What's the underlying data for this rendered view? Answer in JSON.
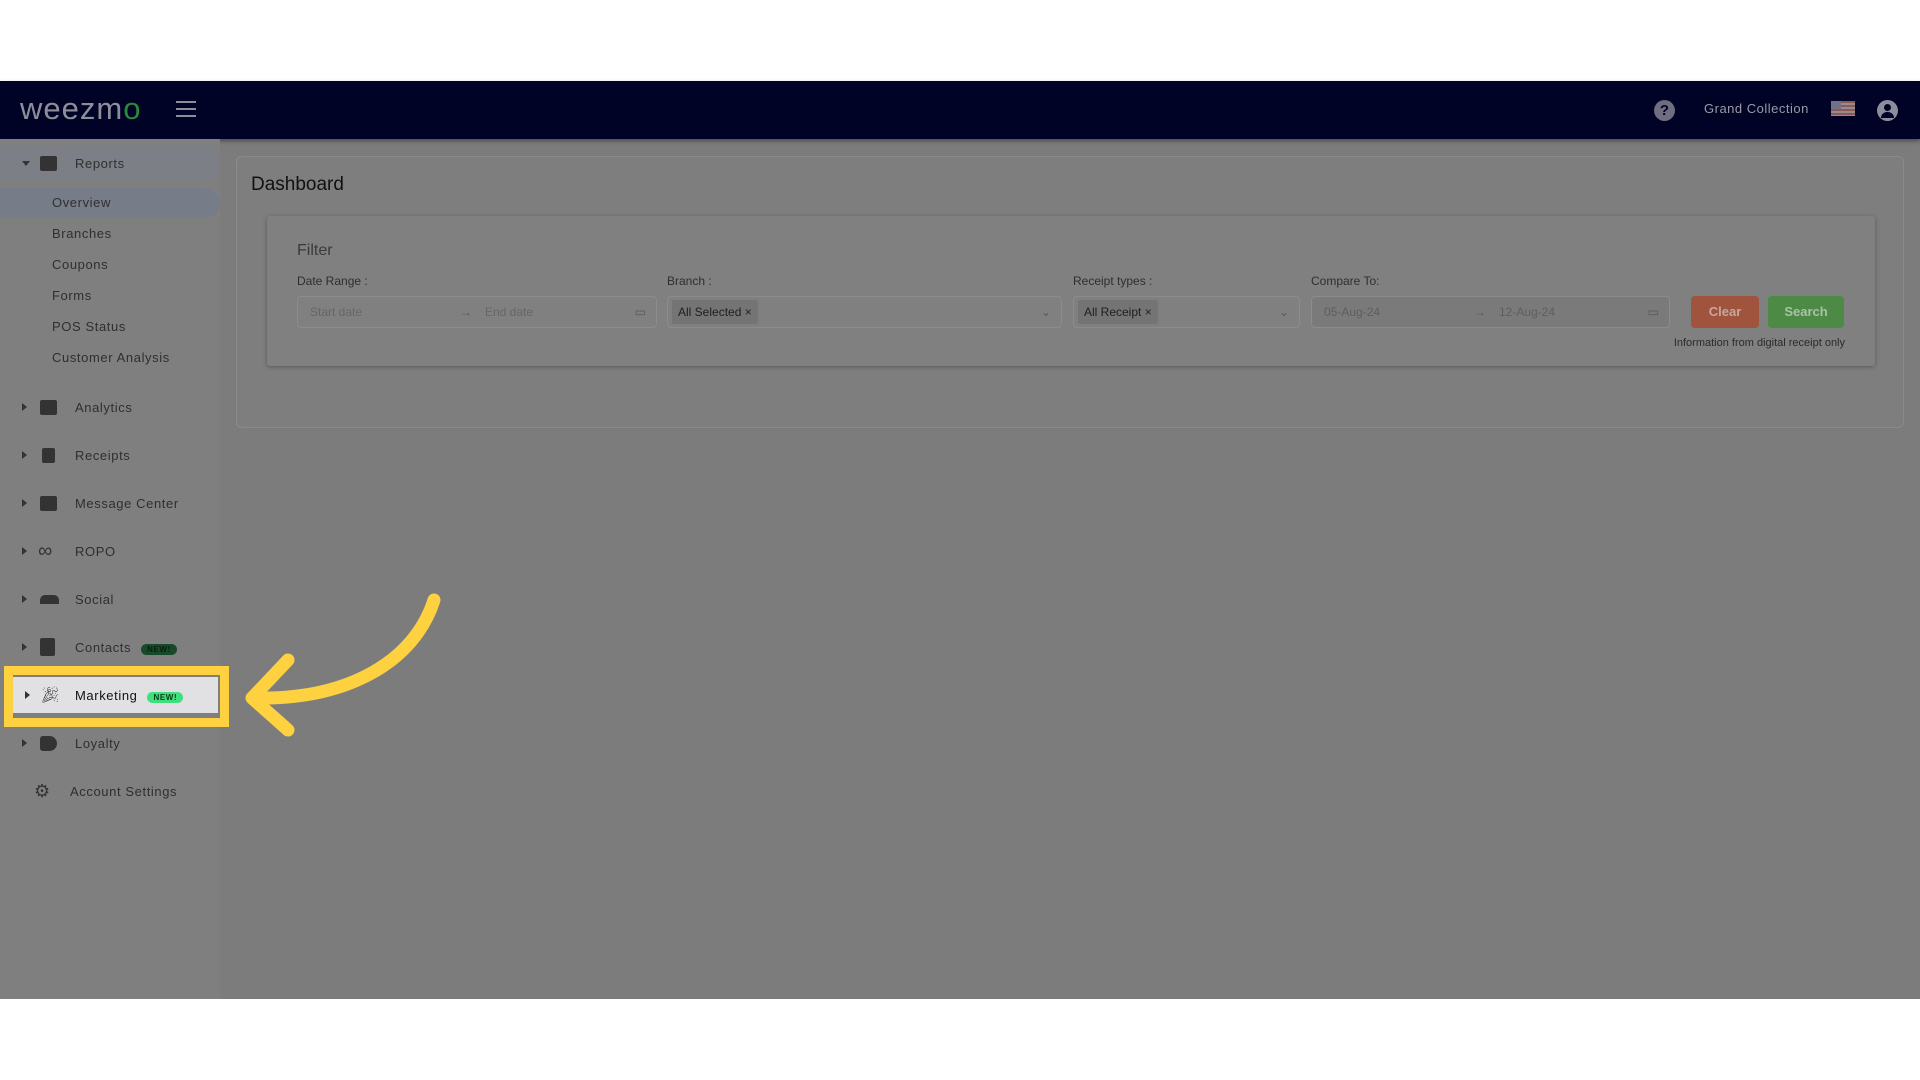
{
  "header": {
    "logo": "weezmo",
    "account_name": "Grand Collection",
    "help_icon": "question-circle-icon",
    "flag_icon": "us-flag-icon",
    "user_icon": "user-circle-icon"
  },
  "sidebar": {
    "reports": {
      "label": "Reports",
      "items": [
        "Overview",
        "Branches",
        "Coupons",
        "Forms",
        "POS Status",
        "Customer Analysis"
      ],
      "active": "Overview"
    },
    "items": [
      {
        "label": "Analytics",
        "icon": "bar-chart-icon"
      },
      {
        "label": "Receipts",
        "icon": "receipt-icon"
      },
      {
        "label": "Message Center",
        "icon": "chat-icon"
      },
      {
        "label": "ROPO",
        "icon": "infinity-icon"
      },
      {
        "label": "Social",
        "icon": "people-icon"
      },
      {
        "label": "Contacts",
        "icon": "contact-card-icon",
        "badge": "NEW!"
      },
      {
        "label": "Marketing",
        "icon": "party-popper-icon",
        "badge": "NEW!"
      },
      {
        "label": "Loyalty",
        "icon": "tag-icon"
      }
    ],
    "account_settings": "Account Settings"
  },
  "main": {
    "title": "Dashboard",
    "filter": {
      "heading": "Filter",
      "date_range": {
        "label": "Date Range :",
        "start_placeholder": "Start date",
        "end_placeholder": "End date"
      },
      "branch": {
        "label": "Branch :",
        "tag": "All Selected"
      },
      "receipt_types": {
        "label": "Receipt types :",
        "tag": "All Receipt"
      },
      "compare_to": {
        "label": "Compare To:",
        "start": "05-Aug-24",
        "end": "12-Aug-24"
      },
      "clear": "Clear",
      "search": "Search",
      "info": "Information from digital receipt only"
    }
  },
  "colors": {
    "header": "#000326",
    "highlight": "#fdd13f",
    "clear": "#a0543e",
    "search": "#4d8a46"
  }
}
